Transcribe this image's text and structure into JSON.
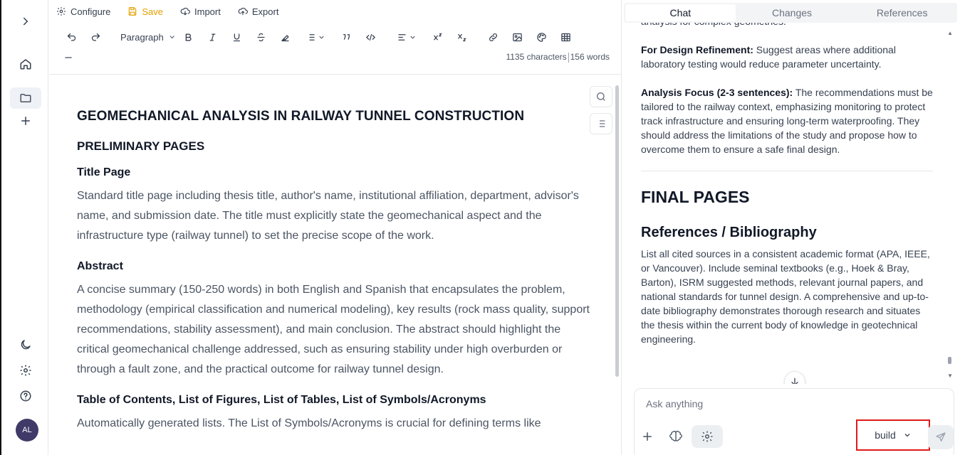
{
  "rail": {
    "avatar_initials": "AL"
  },
  "toolbar": {
    "configure_label": "Configure",
    "save_label": "Save",
    "import_label": "Import",
    "export_label": "Export",
    "paragraph_select": "Paragraph",
    "characters": "1135 characters",
    "words": "156 words"
  },
  "doc": {
    "title": "GEOMECHANICAL ANALYSIS IN RAILWAY TUNNEL CONSTRUCTION",
    "section1": "PRELIMINARY PAGES",
    "title_page_heading": "Title Page",
    "title_page_text": "Standard title page including thesis title, author's name, institutional affiliation, department, advisor's name, and submission date. The title must explicitly state the geomechanical aspect and the infrastructure type (railway tunnel) to set the precise scope of the work.",
    "abstract_heading": "Abstract",
    "abstract_text": "A concise summary (150-250 words) in both English and Spanish that encapsulates the problem, methodology (empirical classification and numerical modeling), key results (rock mass quality, support recommendations, stability assessment), and main conclusion. The abstract should highlight the critical geomechanical challenge addressed, such as ensuring stability under high overburden or through a fault zone, and the practical outcome for railway tunnel design.",
    "toc_heading": "Table of Contents, List of Figures, List of Tables, List of Symbols/Acronyms",
    "toc_text": "Automatically generated lists. The List of Symbols/Acronyms is crucial for defining terms like"
  },
  "panel": {
    "tabs": [
      "Chat",
      "Changes",
      "References"
    ],
    "active_tab": "Chat"
  },
  "chat": {
    "partial_line": "analysis for complex geometries.",
    "refinement_label": "For Design Refinement:",
    "refinement_text": " Suggest areas where additional laboratory testing would reduce parameter uncertainty.",
    "focus_label": "Analysis Focus (2-3 sentences):",
    "focus_text": " The recommendations must be tailored to the railway context, emphasizing monitoring to protect track infrastructure and ensuring long-term waterproofing. They should address the limitations of the study and propose how to overcome them to ensure a safe final design.",
    "final_heading": "FINAL PAGES",
    "refs_heading": "References / Bibliography",
    "refs_text": "List all cited sources in a consistent academic format (APA, IEEE, or Vancouver). Include seminal textbooks (e.g., Hoek & Bray, Barton), ISRM suggested methods, relevant journal papers, and national standards for tunnel design. A comprehensive and up-to-date bibliography demonstrates thorough research and situates the thesis within the current body of knowledge in geotechnical engineering."
  },
  "composer": {
    "placeholder": "Ask anything",
    "model": "build"
  },
  "colors": {
    "save": "#e6a100",
    "highlight_border": "#e01a1a",
    "avatar_bg": "#3f3a67"
  }
}
